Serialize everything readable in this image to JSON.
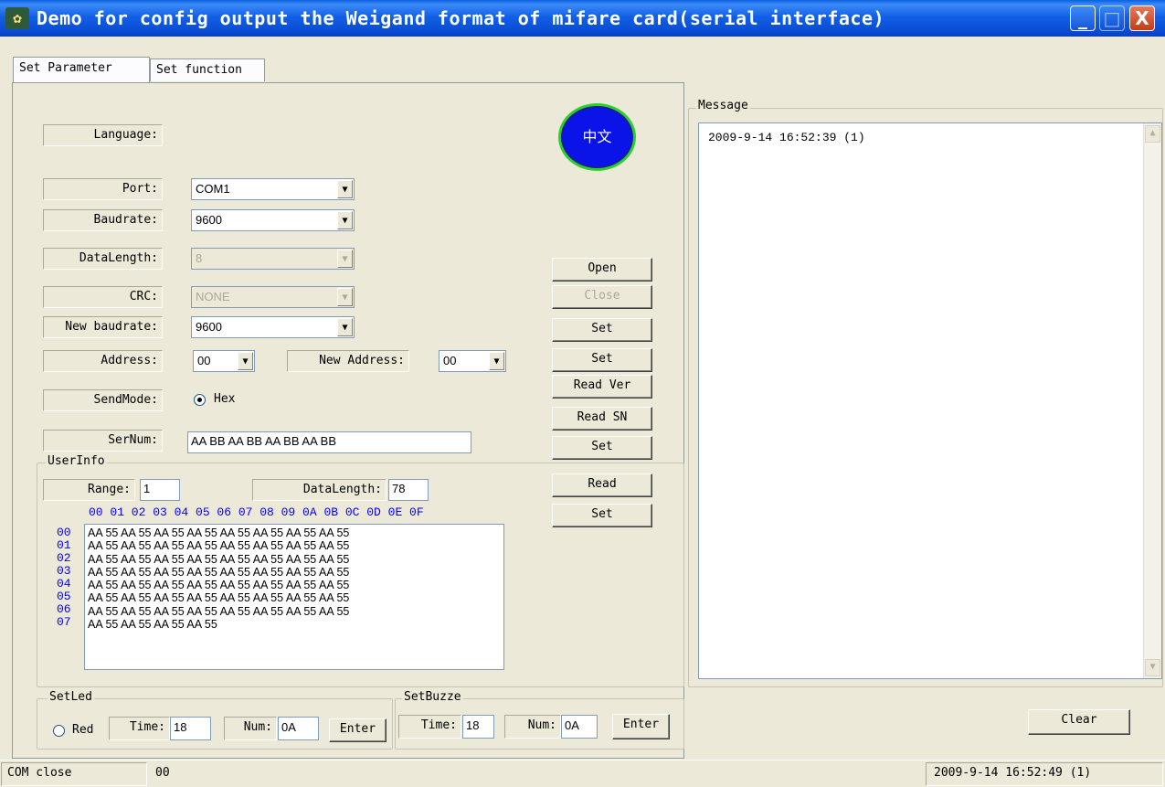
{
  "window": {
    "title": "Demo for config output the Weigand format of mifare card(serial interface)",
    "minimize": "_",
    "maximize": "□",
    "close": "X"
  },
  "tabs": [
    {
      "label": "Set Parameter",
      "active": true
    },
    {
      "label": "Set function",
      "active": false
    }
  ],
  "params": {
    "language_label": "Language:",
    "language_button": "中文",
    "port_label": "Port:",
    "port_value": "COM1",
    "baudrate_label": "Baudrate:",
    "baudrate_value": "9600",
    "datalength_label": "DataLength:",
    "datalength_value": "8",
    "crc_label": "CRC:",
    "crc_value": "NONE",
    "newbaud_label": "New baudrate:",
    "newbaud_value": "9600",
    "address_label": "Address:",
    "address_value": "00",
    "newaddress_label": "New Address:",
    "newaddress_value": "00",
    "sendmode_label": "SendMode:",
    "sendmode_option": "Hex",
    "sernum_label": "SerNum:",
    "sernum_value": "AA BB AA BB AA BB AA BB"
  },
  "buttons": {
    "open": "Open",
    "close": "Close",
    "set_baud": "Set",
    "set_addr": "Set",
    "read_ver": "Read Ver",
    "read_sn": "Read SN",
    "set_sn": "Set",
    "read_user": "Read",
    "set_user": "Set"
  },
  "userinfo": {
    "title": "UserInfo",
    "range_label": "Range:",
    "range_value": "1",
    "datalength_label": "DataLength:",
    "datalength_value": "78",
    "col_header": "00 01 02 03 04 05 06 07 08 09 0A 0B 0C 0D 0E 0F",
    "row_numbers": "00\n01\n02\n03\n04\n05\n06\n07",
    "data": "AA 55 AA 55 AA 55 AA 55 AA 55 AA 55 AA 55 AA 55\nAA 55 AA 55 AA 55 AA 55 AA 55 AA 55 AA 55 AA 55\nAA 55 AA 55 AA 55 AA 55 AA 55 AA 55 AA 55 AA 55\nAA 55 AA 55 AA 55 AA 55 AA 55 AA 55 AA 55 AA 55\nAA 55 AA 55 AA 55 AA 55 AA 55 AA 55 AA 55 AA 55\nAA 55 AA 55 AA 55 AA 55 AA 55 AA 55 AA 55 AA 55\nAA 55 AA 55 AA 55 AA 55 AA 55 AA 55 AA 55 AA 55\nAA 55 AA 55 AA 55 AA 55"
  },
  "setled": {
    "title": "SetLed",
    "radio_label": "Red",
    "time_label": "Time:",
    "time_value": "18",
    "num_label": "Num:",
    "num_value": "0A",
    "enter": "Enter"
  },
  "setbuzz": {
    "title": "SetBuzze",
    "time_label": "Time:",
    "time_value": "18",
    "num_label": "Num:",
    "num_value": "0A",
    "enter": "Enter"
  },
  "message": {
    "title": "Message",
    "lines": [
      "2009-9-14  16:52:39 (1)"
    ],
    "clear": "Clear"
  },
  "status": {
    "com_state": "COM close",
    "address": "00",
    "datetime": "2009-9-14  16:52:49 (1)"
  }
}
